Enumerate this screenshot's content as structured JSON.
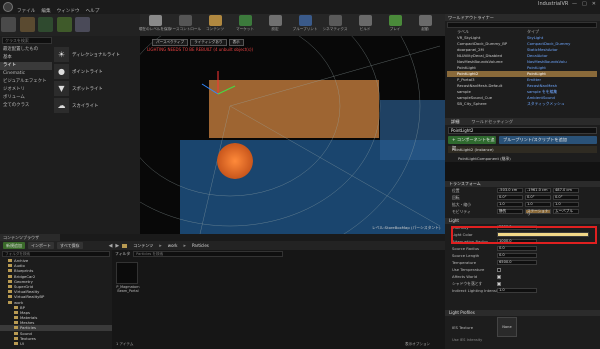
{
  "window": {
    "title": "IndustrialVR",
    "controls": [
      "—",
      "□",
      "✕"
    ]
  },
  "menu": [
    "ファイル",
    "編集",
    "ウィンドウ",
    "ヘルプ"
  ],
  "modes": {
    "search_placeholder": "クラスを検索",
    "categories": [
      "最近配置したもの",
      "基本",
      "ライト",
      "Cinematic",
      "ビジュアルエフェクト",
      "ジオメトリ",
      "ボリューム",
      "全てのクラス"
    ],
    "selected_category": "ライト",
    "lights": [
      {
        "label": "ディレクショナルライト",
        "icon": "sun-icon"
      },
      {
        "label": "ポイントライト",
        "icon": "bulb-icon"
      },
      {
        "label": "スポットライト",
        "icon": "spot-icon"
      },
      {
        "label": "スカイライト",
        "icon": "sky-icon"
      }
    ]
  },
  "toolbar": {
    "buttons": [
      "現在のレベルを保存",
      "ソースコントロール",
      "コンテンツ",
      "マーケット",
      "設定",
      "ブループリント",
      "シネマティクス",
      "ビルド",
      "プレイ",
      "起動"
    ]
  },
  "viewport": {
    "perspective_label": "パースペクティブ",
    "lit_label": "ライティングあり",
    "show_label": "表示",
    "warning": "LIGHTING NEEDS TO BE REBUILT (4 unbuilt object(s))",
    "bottom_left": "レベル: ",
    "bottom_right": "StoreBoxMap (パーシスタント)"
  },
  "outliner": {
    "tab": "ワールドアウトライナー",
    "search_placeholder": "検索...",
    "col_label": "ラベル",
    "col_type": "タイプ",
    "rows": [
      {
        "name": "VR_SkyLight",
        "type": "SkyLight"
      },
      {
        "name": "CompactDock_Dummy_BP",
        "type": "CompactDock_Dummy"
      },
      {
        "name": "doorpanel_2M",
        "type": "StaticMeshActor"
      },
      {
        "name": "NLUtilityDecal_Disabled",
        "type": "DecalActor"
      },
      {
        "name": "NavMeshBoundsVolume",
        "type": "NavMeshBoundsVolu"
      },
      {
        "name": "PointLight",
        "type": "PointLight"
      },
      {
        "name": "PointLight2",
        "type": "PointLight"
      },
      {
        "name": "P_Portal3",
        "type": "Emitter"
      },
      {
        "name": "RecastNavMesh-Default",
        "type": "RecastNavMesh"
      },
      {
        "name": "sample",
        "type": "sample をを編集"
      },
      {
        "name": "sampleSound_Cue",
        "type": "AmbientSound"
      },
      {
        "name": "SB_City_Sphere",
        "type": "スタティックメッシュ"
      }
    ],
    "selected_index": 6
  },
  "details": {
    "tab": "詳細",
    "tab2": "ワールドセッティング",
    "actor_name": "PointLight2",
    "add_component": "+ コンポーネントを追加",
    "blueprint_btn": "ブループリント/スクリプトを追加",
    "component_root": "PointLight2 (Instance)",
    "component_child": "PointLightComponent (継承)",
    "transform_title": "トランスフォーム",
    "transform": [
      {
        "label": "位置",
        "values": [
          "-503.0 cm",
          "-1961.0 cm",
          "487.0 cm"
        ]
      },
      {
        "label": "回転",
        "values": [
          "0.0°",
          "0.0°",
          "0.0°"
        ]
      },
      {
        "label": "拡大・縮小",
        "values": [
          "1.0",
          "1.0",
          "1.0"
        ]
      },
      {
        "label": "モビリティ",
        "values": [
          "静的",
          "ステーショナリ",
          "ムーバブル"
        ]
      }
    ],
    "light_title": "Light",
    "light_props": [
      {
        "label": "Intensity",
        "value": "5000.0"
      },
      {
        "label": "Light Color",
        "value": ""
      },
      {
        "label": "Attenuation Radius",
        "value": "1000.0"
      },
      {
        "label": "Source Radius",
        "value": "0.0"
      },
      {
        "label": "Source Length",
        "value": "0.0"
      },
      {
        "label": "Temperature",
        "value": "6500.0"
      },
      {
        "label": "Use Temperature",
        "value": ""
      },
      {
        "label": "Affects World",
        "value": ""
      },
      {
        "label": "シャドウを落とす",
        "value": ""
      },
      {
        "label": "Indirect Lighting Intensity",
        "value": "1.0"
      }
    ],
    "light_profiles_title": "Light Profiles",
    "ies_label": "IES Texture",
    "ies_value": "None",
    "ies_brightness": "Use IES Intensity"
  },
  "content_browser": {
    "tab": "コンテンツブラウザ",
    "add_new": "新規追加",
    "import": "インポート",
    "save_all": "すべて保存",
    "path": [
      "コンテンツ",
      "work",
      "Particles"
    ],
    "folder_search_placeholder": "フォルダを検索",
    "filter_label": "フィルタ",
    "asset_search_placeholder": "Particles を検索",
    "tree": [
      "Archive",
      "Audio",
      "Blueprints",
      "BridgeCar2",
      "Geometry",
      "SuperGrid",
      "VirtualReality",
      "VirtualRealityBP",
      "work",
      "BP",
      "Maps",
      "Materials",
      "Meshes",
      "Particles",
      "Sound",
      "Textures",
      "UI"
    ],
    "asset_name": "P_Magmatorn Beam_Portal",
    "item_count": "1 アイテム",
    "view_options": "表示オプション"
  },
  "colors": {
    "selection": "#8a6a3a",
    "highlight": "#e02020",
    "add_green": "#2f6a2f",
    "bp_blue": "#2a5278"
  }
}
